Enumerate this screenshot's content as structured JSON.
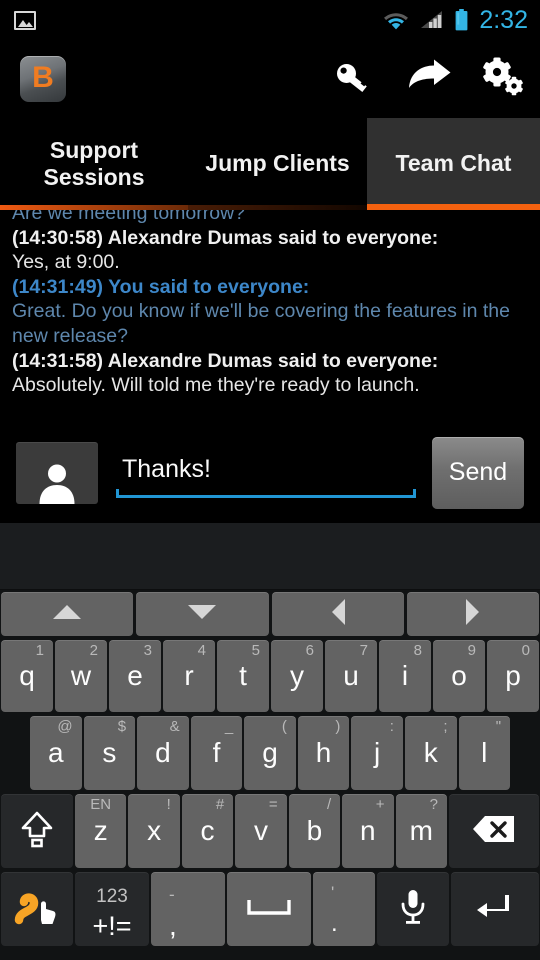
{
  "status_bar": {
    "time": "2:32",
    "icons": [
      "image-icon",
      "wifi-icon",
      "cellular-signal-icon",
      "battery-icon"
    ],
    "accent_color": "#33b5e5"
  },
  "action_bar": {
    "app_logo_letter": "B",
    "app_logo_color": "#f07c21",
    "actions": [
      "key-icon",
      "share-arrow-icon",
      "settings-gears-icon"
    ]
  },
  "tabs": {
    "items": [
      {
        "label": "Support Sessions",
        "selected": false
      },
      {
        "label": "Jump Clients",
        "selected": false
      },
      {
        "label": "Team Chat",
        "selected": true
      }
    ],
    "selected_accent": "#f4610f"
  },
  "chat": {
    "messages": [
      {
        "header": "",
        "body": "Are we meeting tomorrow?",
        "self": true,
        "clipped": true
      },
      {
        "header": "(14:30:58) Alexandre Dumas said to everyone:",
        "body": "Yes, at 9:00.",
        "self": false,
        "clipped": false
      },
      {
        "header": "(14:31:49) You said to everyone:",
        "body": "Great. Do you know if we'll be covering the features in the new release?",
        "self": true,
        "clipped": false
      },
      {
        "header": "(14:31:58) Alexandre Dumas said to everyone:",
        "body": "Absolutely. Will told me they're ready to launch.",
        "self": false,
        "clipped": false
      }
    ]
  },
  "composer": {
    "avatar_icon": "person-avatar-icon",
    "input_value": "Thanks!",
    "input_placeholder": "",
    "send_label": "Send",
    "underline_color": "#2196d4"
  },
  "keyboard": {
    "nav_row": [
      {
        "name": "arrow-up-icon"
      },
      {
        "name": "arrow-down-icon"
      },
      {
        "name": "arrow-left-icon"
      },
      {
        "name": "arrow-right-icon"
      }
    ],
    "row1": [
      {
        "main": "q",
        "hint": "1"
      },
      {
        "main": "w",
        "hint": "2"
      },
      {
        "main": "e",
        "hint": "3"
      },
      {
        "main": "r",
        "hint": "4"
      },
      {
        "main": "t",
        "hint": "5"
      },
      {
        "main": "y",
        "hint": "6"
      },
      {
        "main": "u",
        "hint": "7"
      },
      {
        "main": "i",
        "hint": "8"
      },
      {
        "main": "o",
        "hint": "9"
      },
      {
        "main": "p",
        "hint": "0"
      }
    ],
    "row2": [
      {
        "main": "a",
        "hint": "@"
      },
      {
        "main": "s",
        "hint": "$"
      },
      {
        "main": "d",
        "hint": "&"
      },
      {
        "main": "f",
        "hint": "_"
      },
      {
        "main": "g",
        "hint": "("
      },
      {
        "main": "h",
        "hint": ")"
      },
      {
        "main": "j",
        "hint": ":"
      },
      {
        "main": "k",
        "hint": ";"
      },
      {
        "main": "l",
        "hint": "\""
      }
    ],
    "row3": [
      {
        "main": "z",
        "hint": "EN"
      },
      {
        "main": "x",
        "hint": "!"
      },
      {
        "main": "c",
        "hint": "#"
      },
      {
        "main": "v",
        "hint": "="
      },
      {
        "main": "b",
        "hint": "/"
      },
      {
        "main": "n",
        "hint": "+"
      },
      {
        "main": "m",
        "hint": "?"
      }
    ],
    "shift_key": "shift-icon",
    "backspace_key": "backspace-icon",
    "row4": {
      "swipe_key": "swipe-gesture-icon",
      "symbols_hint": "123",
      "symbols_main": "+!=",
      "comma_hint": "-",
      "comma_main": ",",
      "space_key": "space-bar-icon",
      "period_hint": "'",
      "period_main": ".",
      "mic_key": "microphone-icon",
      "enter_key": "enter-return-icon"
    }
  }
}
